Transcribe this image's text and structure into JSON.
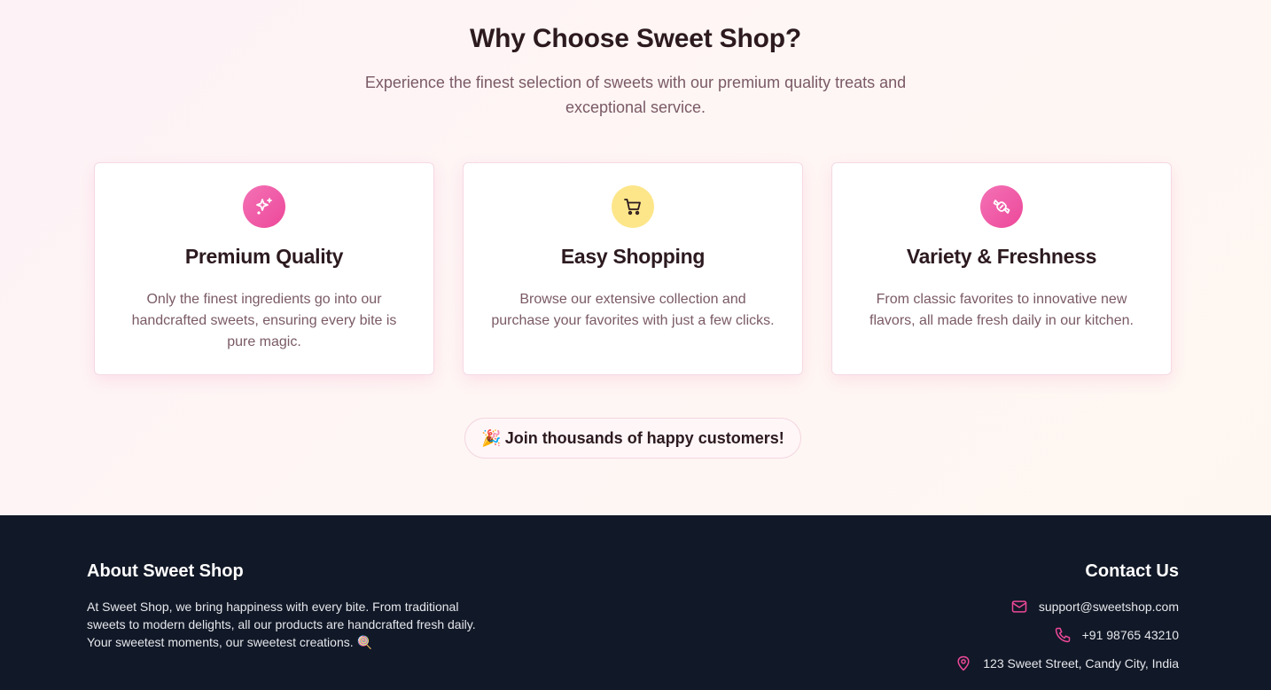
{
  "features": {
    "title": "Why Choose Sweet Shop?",
    "subtitle": "Experience the finest selection of sweets with our premium quality treats and exceptional service.",
    "cards": [
      {
        "icon": "sparkles-icon",
        "title": "Premium Quality",
        "description": "Only the finest ingredients go into our handcrafted sweets, ensuring every bite is pure magic."
      },
      {
        "icon": "shopping-cart-icon",
        "title": "Easy Shopping",
        "description": "Browse our extensive collection and purchase your favorites with just a few clicks."
      },
      {
        "icon": "candy-icon",
        "title": "Variety & Freshness",
        "description": "From classic favorites to innovative new flavors, all made fresh daily in our kitchen."
      }
    ],
    "badge": {
      "emoji": "🎉",
      "text": "Join thousands of happy customers!"
    }
  },
  "footer": {
    "about": {
      "title": "About Sweet Shop",
      "text": "At Sweet Shop, we bring happiness with every bite. From traditional sweets to modern delights, all our products are handcrafted fresh daily. Your sweetest moments, our sweetest creations. 🍭"
    },
    "contact": {
      "title": "Contact Us",
      "email": "support@sweetshop.com",
      "phone": "+91 98765 43210",
      "address": "123 Sweet Street, Candy City, India"
    }
  },
  "colors": {
    "accent_pink": "#ec4899",
    "accent_yellow": "#fde68a",
    "footer_bg": "#111827",
    "heading": "#2c1a1f",
    "body_text": "#7a5a66"
  }
}
